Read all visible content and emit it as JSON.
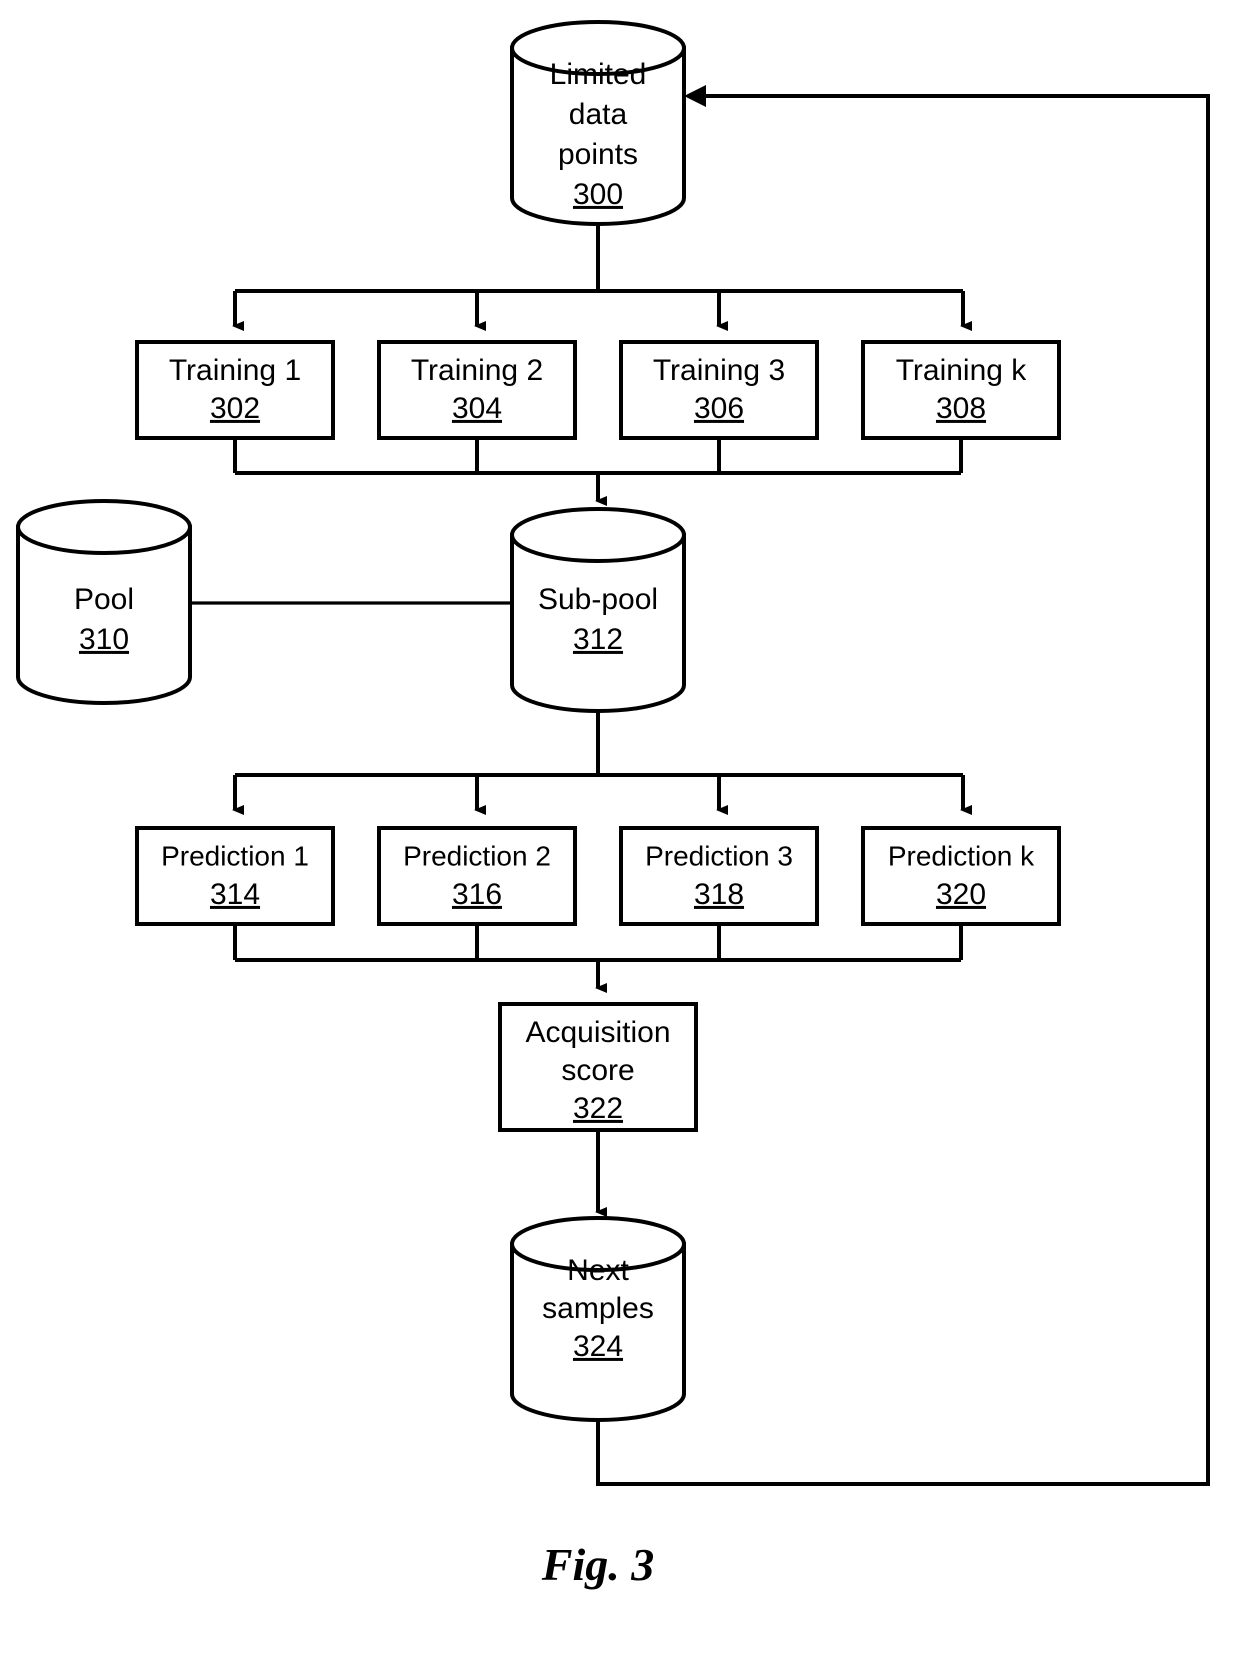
{
  "figure": {
    "caption": "Fig. 3",
    "title": "Active learning loop flow diagram"
  },
  "nodes": {
    "limited_data": {
      "shape": "cylinder",
      "line1": "Limited",
      "line2": "data",
      "line3": "points",
      "ref": "300"
    },
    "training": [
      {
        "label": "Training 1",
        "ref": "302"
      },
      {
        "label": "Training 2",
        "ref": "304"
      },
      {
        "label": "Training 3",
        "ref": "306"
      },
      {
        "label": "Training k",
        "ref": "308"
      }
    ],
    "pool": {
      "shape": "cylinder",
      "label": "Pool",
      "ref": "310"
    },
    "subpool": {
      "shape": "cylinder",
      "label": "Sub-pool",
      "ref": "312"
    },
    "prediction": [
      {
        "label": "Prediction 1",
        "ref": "314"
      },
      {
        "label": "Prediction 2",
        "ref": "316"
      },
      {
        "label": "Prediction 3",
        "ref": "318"
      },
      {
        "label": "Prediction k",
        "ref": "320"
      }
    ],
    "acquisition": {
      "shape": "rect",
      "line1": "Acquisition",
      "line2": "score",
      "ref": "322"
    },
    "next_samples": {
      "shape": "cylinder",
      "line1": "Next",
      "line2": "samples",
      "ref": "324"
    }
  },
  "colors": {
    "stroke": "#000000",
    "fill": "#ffffff",
    "text": "#000000"
  }
}
